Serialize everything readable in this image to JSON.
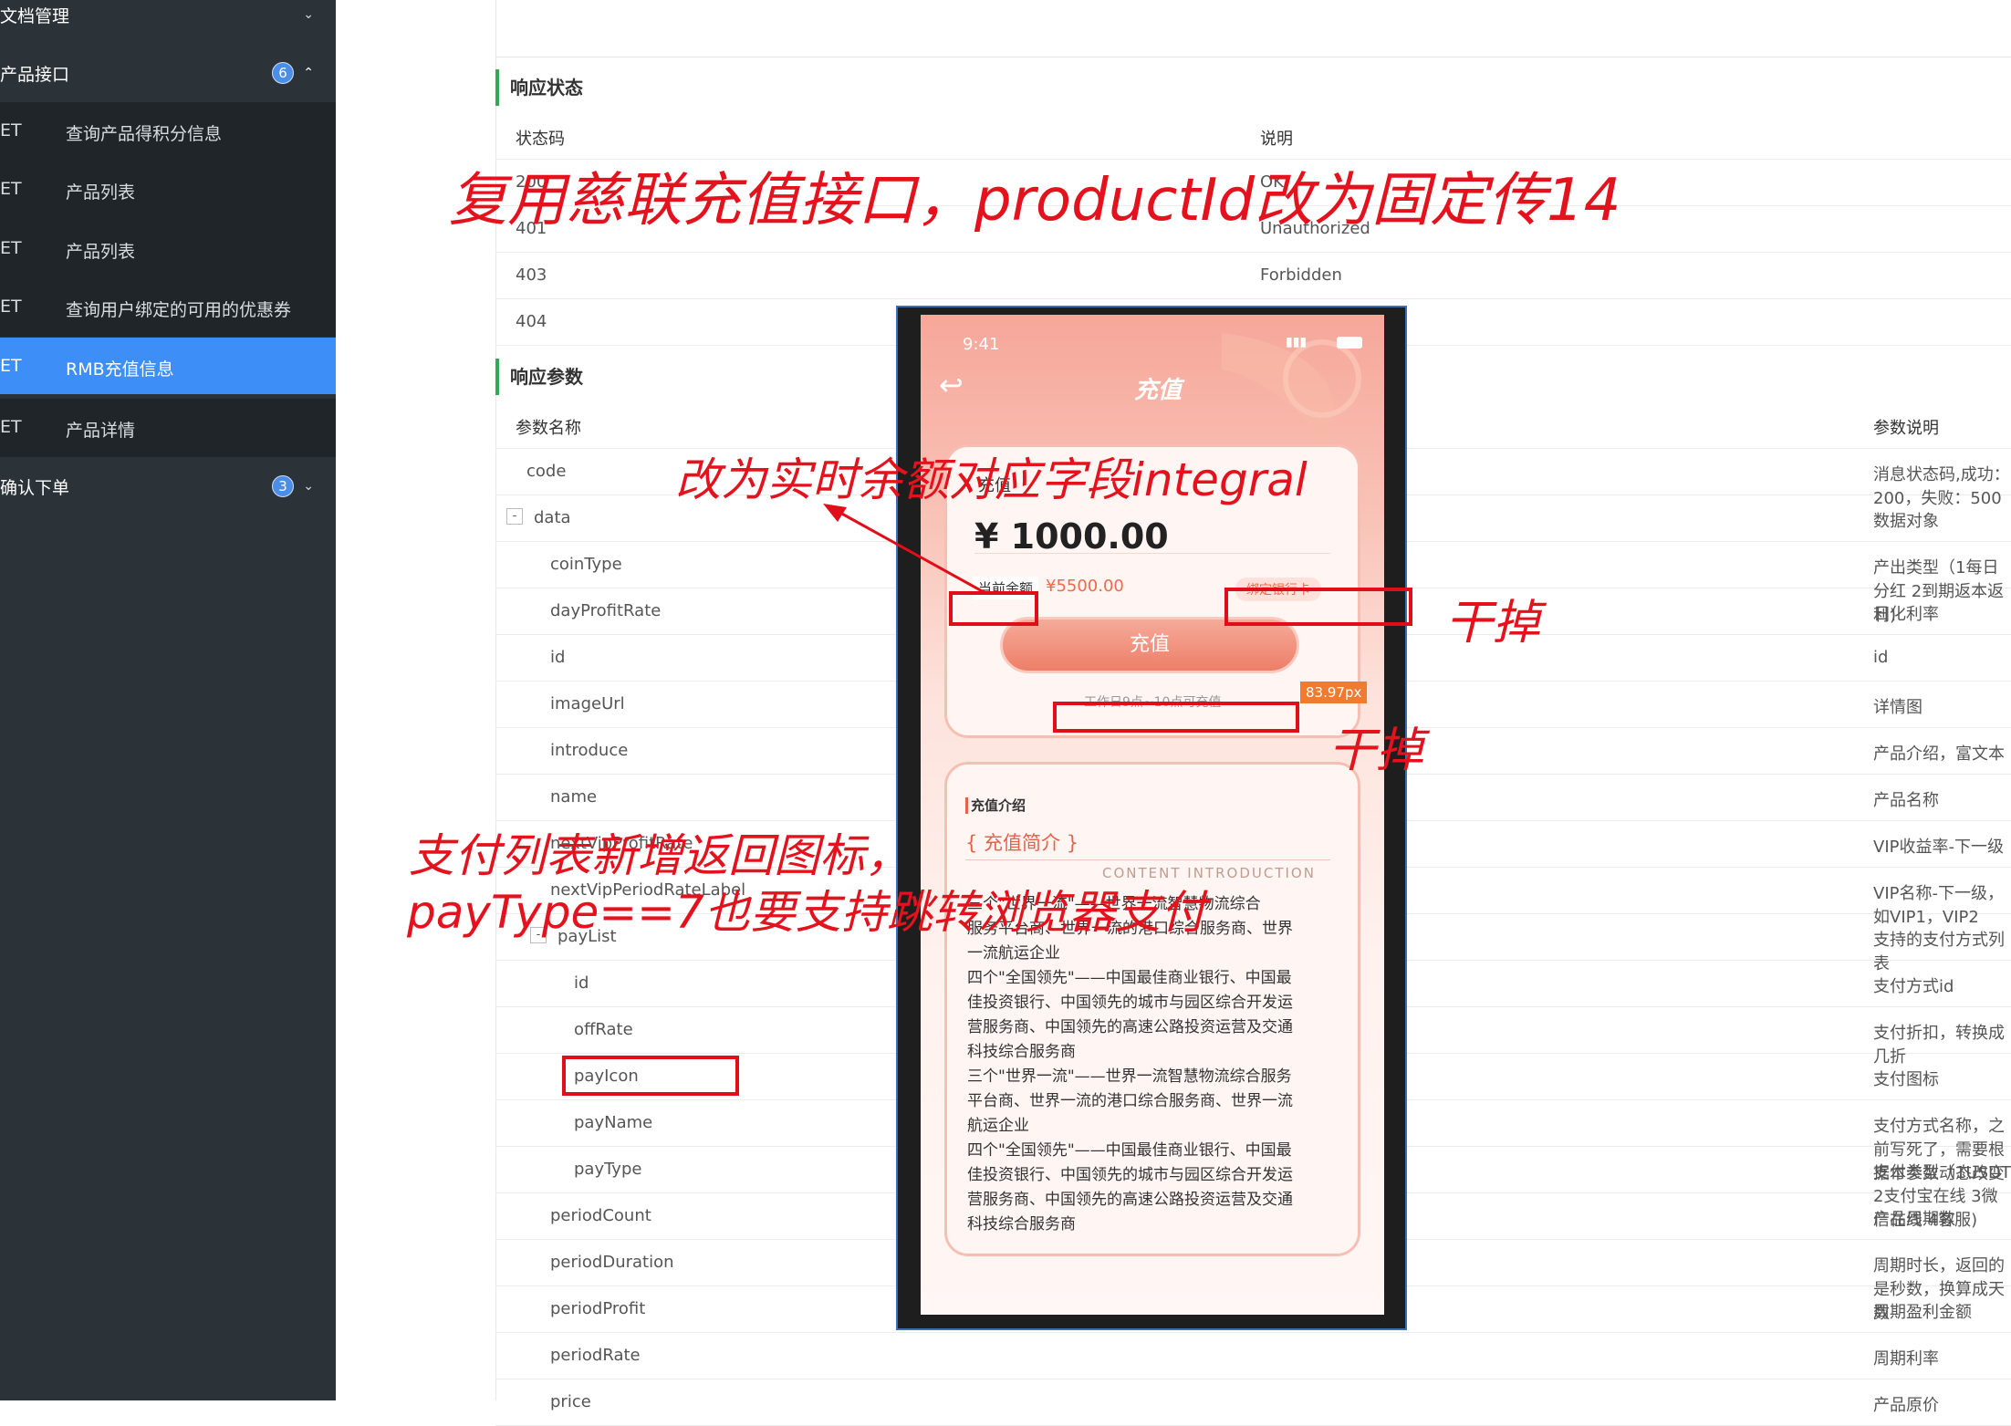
{
  "sidebar": {
    "doc_mgmt": "文档管理",
    "product_api": "产品接口",
    "product_api_badge": "6",
    "items": [
      {
        "method": "ET",
        "label": "查询产品得积分信息"
      },
      {
        "method": "ET",
        "label": "产品列表"
      },
      {
        "method": "ET",
        "label": "产品列表"
      },
      {
        "method": "ET",
        "label": "查询用户绑定的可用的优惠券"
      },
      {
        "method": "ET",
        "label": "RMB充值信息"
      },
      {
        "method": "ET",
        "label": "产品详情"
      }
    ],
    "confirm_order": "确认下单",
    "confirm_order_badge": "3"
  },
  "response_status": {
    "title": "响应状态",
    "col_code": "状态码",
    "col_desc": "说明",
    "rows": [
      {
        "code": "200",
        "desc": "OK"
      },
      {
        "code": "401",
        "desc": "Unauthorized"
      },
      {
        "code": "403",
        "desc": "Forbidden"
      },
      {
        "code": "404",
        "desc": ""
      }
    ]
  },
  "response_params": {
    "title": "响应参数",
    "col_name": "参数名称",
    "col_desc": "参数说明",
    "rows": [
      {
        "name": "code",
        "desc": "消息状态码,成功：200，失败：500"
      },
      {
        "name": "data",
        "desc": "数据对象"
      },
      {
        "name": "coinType",
        "desc": "产出类型（1每日分红 2到期返本返利)"
      },
      {
        "name": "dayProfitRate",
        "desc": "日化利率"
      },
      {
        "name": "id",
        "desc": "id"
      },
      {
        "name": "imageUrl",
        "desc": "详情图"
      },
      {
        "name": "introduce",
        "desc": "产品介绍，富文本"
      },
      {
        "name": "name",
        "desc": "产品名称"
      },
      {
        "name": "nextVipProfitRate",
        "desc": "VIP收益率-下一级"
      },
      {
        "name": "nextVipPeriodRateLabel",
        "desc": "VIP名称-下一级，如VIP1，VIP2"
      },
      {
        "name": "payList",
        "desc": "支持的支付方式列表"
      },
      {
        "name": "id",
        "desc": "支付方式id"
      },
      {
        "name": "offRate",
        "desc": "支付折扣，转换成几折"
      },
      {
        "name": "payIcon",
        "desc": "支付图标"
      },
      {
        "name": "payName",
        "desc": "支付方式名称，之前写死了，需要根据本参数动态改变"
      },
      {
        "name": "payType",
        "desc": "支付类型（1USDT 2支付宝在线 3微信在线 4客服)"
      },
      {
        "name": "periodCount",
        "desc": "产品周期数"
      },
      {
        "name": "periodDuration",
        "desc": "周期时长，返回的是秒数，换算成天数"
      },
      {
        "name": "periodProfit",
        "desc": "周期盈利金额"
      },
      {
        "name": "periodRate",
        "desc": "周期利率"
      },
      {
        "name": "price",
        "desc": "产品原价"
      }
    ]
  },
  "phone": {
    "time": "9:41",
    "title": "充值",
    "amount_label": "充值",
    "amount": "¥ 1000.00",
    "balance_label": "当前余额",
    "balance_value": "¥5500.00",
    "bind_card": "绑定银行卡",
    "recharge_button": "充值",
    "hours_note": "工作日9点~10点可充值",
    "measure_badge": "83.97px",
    "intro_header": "充值介绍",
    "intro_title": "{ 充值简介 }",
    "intro_subtitle": "CONTENT INTRODUCTION",
    "intro_lines": [
      "三个\"世界一流\"——世界一流智慧物流综合",
      "服务平台商、世界一流的港口综合服务商、世界",
      "一流航运企业",
      "四个\"全国领先\"——中国最佳商业银行、中国最",
      "佳投资银行、中国领先的城市与园区综合开发运",
      "营服务商、中国领先的高速公路投资运营及交通",
      "科技综合服务商",
      "三个\"世界一流\"——世界一流智慧物流综合服务",
      "平台商、世界一流的港口综合服务商、世界一流",
      "航运企业",
      "四个\"全国领先\"——中国最佳商业银行、中国最",
      "佳投资银行、中国领先的城市与园区综合开发运",
      "营服务商、中国领先的高速公路投资运营及交通",
      "科技综合服务商"
    ]
  },
  "annotations": {
    "top": "复用慈联充值接口，productId改为固定传14",
    "balance": "改为实时余额对应字段integral",
    "remove1": "干掉",
    "remove2": "干掉",
    "paylist1": "支付列表新增返回图标，",
    "paylist2": "payType==7也要支持跳转浏览器支付"
  },
  "colors": {
    "sidebar_bg": "#2b3238",
    "active": "#3e8ef7",
    "accent_green": "#34a853",
    "annotation_red": "#e4121d"
  }
}
